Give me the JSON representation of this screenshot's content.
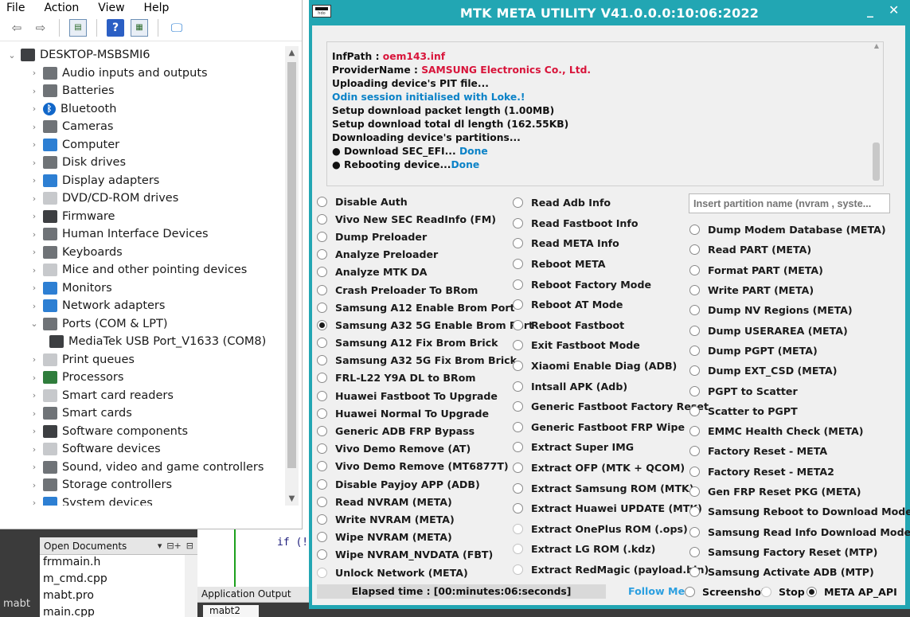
{
  "device_manager": {
    "menu": [
      "File",
      "Action",
      "View",
      "Help"
    ],
    "root": "DESKTOP-MSBSMI6",
    "items": [
      {
        "label": "Audio inputs and outputs",
        "icon": "speaker-icon",
        "expanded": false
      },
      {
        "label": "Batteries",
        "icon": "battery-icon",
        "expanded": false
      },
      {
        "label": "Bluetooth",
        "icon": "bluetooth-icon",
        "expanded": false
      },
      {
        "label": "Cameras",
        "icon": "camera-icon",
        "expanded": false
      },
      {
        "label": "Computer",
        "icon": "computer-icon",
        "expanded": false
      },
      {
        "label": "Disk drives",
        "icon": "disk-drive-icon",
        "expanded": false
      },
      {
        "label": "Display adapters",
        "icon": "display-adapter-icon",
        "expanded": false
      },
      {
        "label": "DVD/CD-ROM drives",
        "icon": "dvd-drive-icon",
        "expanded": false
      },
      {
        "label": "Firmware",
        "icon": "firmware-icon",
        "expanded": false
      },
      {
        "label": "Human Interface Devices",
        "icon": "hid-icon",
        "expanded": false
      },
      {
        "label": "Keyboards",
        "icon": "keyboard-icon",
        "expanded": false
      },
      {
        "label": "Mice and other pointing devices",
        "icon": "mouse-icon",
        "expanded": false
      },
      {
        "label": "Monitors",
        "icon": "monitor-icon",
        "expanded": false
      },
      {
        "label": "Network adapters",
        "icon": "network-adapter-icon",
        "expanded": false
      },
      {
        "label": "Ports (COM & LPT)",
        "icon": "port-icon",
        "expanded": true
      },
      {
        "label": "MediaTek USB Port_V1633 (COM8)",
        "icon": "usb-port-icon",
        "child": true
      },
      {
        "label": "Print queues",
        "icon": "printer-icon",
        "expanded": false
      },
      {
        "label": "Processors",
        "icon": "processor-icon",
        "expanded": false
      },
      {
        "label": "Smart card readers",
        "icon": "smart-card-reader-icon",
        "expanded": false
      },
      {
        "label": "Smart cards",
        "icon": "smart-card-icon",
        "expanded": false
      },
      {
        "label": "Software components",
        "icon": "software-component-icon",
        "expanded": false
      },
      {
        "label": "Software devices",
        "icon": "software-device-icon",
        "expanded": false
      },
      {
        "label": "Sound, video and game controllers",
        "icon": "sound-controller-icon",
        "expanded": false
      },
      {
        "label": "Storage controllers",
        "icon": "storage-controller-icon",
        "expanded": false
      },
      {
        "label": "System devices",
        "icon": "system-device-icon",
        "expanded": false
      }
    ]
  },
  "ide": {
    "open_documents_title": "Open Documents",
    "documents": [
      "frmmain.h",
      "m_cmd.cpp",
      "mabt.pro",
      "main.cpp"
    ],
    "project_label": "mabt",
    "app_output_title": "Application Output",
    "output_tab": "mabt2",
    "code_fragment": "if (!"
  },
  "mtk": {
    "title": "MTK META UTILITY V41.0.0.0:10:06:2022",
    "controls": {
      "minimize": "_",
      "close": "✕"
    },
    "log": [
      {
        "parts": [
          {
            "t": "InfPath : ",
            "c": "plain"
          },
          {
            "t": "oem143.inf",
            "c": "red"
          }
        ]
      },
      {
        "parts": [
          {
            "t": "ProviderName : ",
            "c": "plain"
          },
          {
            "t": "SAMSUNG Electronics Co., Ltd.",
            "c": "red"
          }
        ]
      },
      {
        "parts": [
          {
            "t": "Uploading device's PIT file...",
            "c": "plain"
          }
        ]
      },
      {
        "parts": [
          {
            "t": "Odin session initialised with Loke.!",
            "c": "blue"
          }
        ]
      },
      {
        "parts": [
          {
            "t": "Setup download packet length (1.00MB)",
            "c": "plain"
          }
        ]
      },
      {
        "parts": [
          {
            "t": "Setup download total dl length (162.55KB)",
            "c": "plain"
          }
        ]
      },
      {
        "parts": [
          {
            "t": "Downloading device's partitions...",
            "c": "plain"
          }
        ]
      },
      {
        "parts": [
          {
            "t": "● Download SEC_EFI... ",
            "c": "plain"
          },
          {
            "t": "Done",
            "c": "blue"
          }
        ]
      },
      {
        "parts": [
          {
            "t": "● Rebooting device...",
            "c": "plain"
          },
          {
            "t": "Done",
            "c": "teal"
          }
        ]
      }
    ],
    "partition_placeholder": "Insert partition name (nvram , syste...",
    "col1": [
      {
        "label": "Disable Auth"
      },
      {
        "label": "Vivo New SEC ReadInfo (FM)"
      },
      {
        "label": "Dump Preloader"
      },
      {
        "label": "Analyze Preloader"
      },
      {
        "label": "Analyze MTK DA"
      },
      {
        "label": "Crash Preloader To BRom"
      },
      {
        "label": "Samsung A12 Enable Brom Port"
      },
      {
        "label": "Samsung A32 5G Enable Brom Port",
        "selected": true
      },
      {
        "label": "Samsung A12 Fix Brom Brick"
      },
      {
        "label": "Samsung A32 5G Fix Brom Brick"
      },
      {
        "label": "FRL-L22 Y9A DL to BRom"
      },
      {
        "label": "Huawei Fastboot To Upgrade"
      },
      {
        "label": "Huawei Normal To Upgrade"
      },
      {
        "label": "Generic ADB FRP Bypass"
      },
      {
        "label": "Vivo Demo Remove (AT)"
      },
      {
        "label": "Vivo Demo Remove (MT6877T)"
      },
      {
        "label": "Disable Payjoy APP (ADB)"
      },
      {
        "label": "Read NVRAM (META)"
      },
      {
        "label": "Write NVRAM (META)"
      },
      {
        "label": "Wipe NVRAM (META)"
      },
      {
        "label": "Wipe NVRAM_NVDATA (FBT)"
      },
      {
        "label": "Unlock Network (META)",
        "disabled": true
      }
    ],
    "col2": [
      {
        "label": "Read Adb Info"
      },
      {
        "label": "Read Fastboot Info"
      },
      {
        "label": "Read META Info"
      },
      {
        "label": "Reboot META"
      },
      {
        "label": "Reboot Factory Mode"
      },
      {
        "label": "Reboot AT Mode"
      },
      {
        "label": "Reboot Fastboot"
      },
      {
        "label": "Exit Fastboot Mode"
      },
      {
        "label": "Xiaomi Enable Diag (ADB)"
      },
      {
        "label": "Intsall APK (Adb)"
      },
      {
        "label": "Generic Fastboot Factory Reset"
      },
      {
        "label": "Generic Fastboot FRP Wipe"
      },
      {
        "label": "Extract Super IMG"
      },
      {
        "label": "Extract OFP (MTK + QCOM)"
      },
      {
        "label": "Extract Samsung ROM (MTK)"
      },
      {
        "label": "Extract Huawei UPDATE (MTK)"
      },
      {
        "label": "Extract OnePlus ROM (.ops)",
        "disabled": true
      },
      {
        "label": "Extract LG ROM (.kdz)",
        "disabled": true
      },
      {
        "label": "Extract RedMagic (payload.bin)",
        "disabled": true
      }
    ],
    "col3": [
      {
        "label": "Dump Modem Database (META)"
      },
      {
        "label": "Read PART (META)"
      },
      {
        "label": "Format PART (META)"
      },
      {
        "label": "Write PART (META)"
      },
      {
        "label": "Dump NV Regions (META)"
      },
      {
        "label": "Dump USERAREA (META)"
      },
      {
        "label": "Dump PGPT (META)"
      },
      {
        "label": "Dump  EXT_CSD (META)"
      },
      {
        "label": "PGPT to Scatter"
      },
      {
        "label": "Scatter to PGPT"
      },
      {
        "label": "EMMC Health Check (META)"
      },
      {
        "label": "Factory Reset - META"
      },
      {
        "label": "Factory Reset - META2"
      },
      {
        "label": "Gen FRP Reset PKG (META)"
      },
      {
        "label": "Samsung Reboot to Download Mode"
      },
      {
        "label": "Samsung Read Info Download Mode"
      },
      {
        "label": "Samsung Factory Reset (MTP)"
      },
      {
        "label": "Samsung Activate ADB (MTP)"
      }
    ],
    "status": "Elapsed time : [00:minutes:06:seconds]",
    "follow_me": "Follow Me",
    "bottom": [
      {
        "label": "Screenshot",
        "selected": false
      },
      {
        "label": "Stop",
        "selected": false,
        "disabled": true
      },
      {
        "label": "META AP_API",
        "selected": true
      }
    ],
    "colors": {
      "title_bar": "#22a6b3",
      "log_red": "#d8143a",
      "log_blue": "#0b82c7",
      "link": "#2b9fe0"
    }
  }
}
